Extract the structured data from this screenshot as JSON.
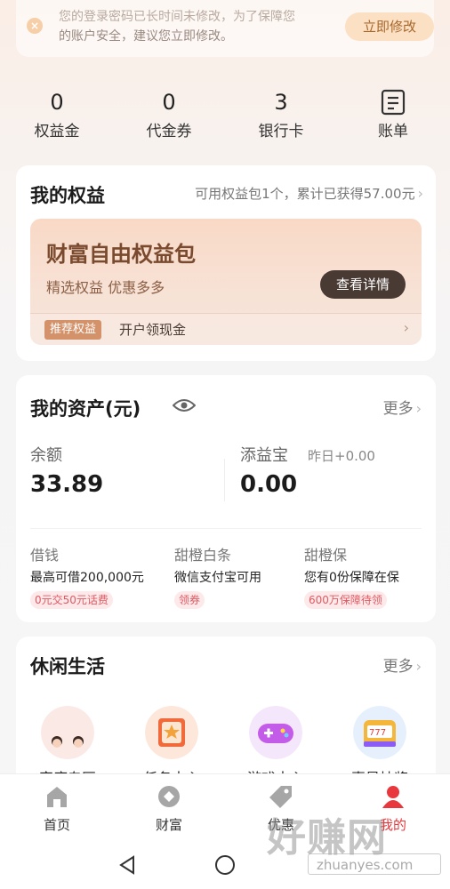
{
  "notice": {
    "line1": "您的登录密码已长时间未修改，为了保障您",
    "line2": "的账户安全，建议您立即修改。",
    "button": "立即修改"
  },
  "stats": [
    {
      "value": "0",
      "label": "权益金"
    },
    {
      "value": "0",
      "label": "代金券"
    },
    {
      "value": "3",
      "label": "银行卡"
    },
    {
      "label": "账单"
    }
  ],
  "benefits": {
    "title": "我的权益",
    "summary": "可用权益包1个，累计已获得57.00元",
    "pack_title": "财富自由权益包",
    "pack_subtitle": "精选权益 优惠多多",
    "pack_button": "查看详情",
    "tag": "推荐权益",
    "footer_text": "开户领现金"
  },
  "assets": {
    "title": "我的资产(元)",
    "more": "更多",
    "balance_label": "余额",
    "balance_value": "33.89",
    "tianyibao_label": "添益宝",
    "tianyibao_value": "0.00",
    "yesterday": "昨日+0.00",
    "products": [
      {
        "name": "借钱",
        "desc": "最高可借200,000元",
        "tag": "0元交50元话费"
      },
      {
        "name": "甜橙白条",
        "desc": "微信支付宝可用",
        "tag": "领券"
      },
      {
        "name": "甜橙保",
        "desc": "您有0份保障在保",
        "tag": "600万保障待领"
      }
    ]
  },
  "leisure": {
    "title": "休闲生活",
    "more": "更多",
    "items": [
      {
        "label": "家庭专区",
        "icon": "family-icon"
      },
      {
        "label": "任务中心",
        "icon": "task-icon"
      },
      {
        "label": "游戏中心",
        "icon": "gamepad-icon"
      },
      {
        "label": "惠星抽奖",
        "icon": "slot-machine-icon"
      }
    ]
  },
  "tabbar": [
    {
      "label": "首页",
      "icon": "home-icon"
    },
    {
      "label": "财富",
      "icon": "wealth-icon"
    },
    {
      "label": "优惠",
      "icon": "coupon-icon"
    },
    {
      "label": "我的",
      "icon": "profile-icon"
    }
  ],
  "watermark": {
    "brand": "好赚网",
    "url": "zhuanyes.com"
  },
  "colors": {
    "accent": "#e8383d",
    "gold": "#a8672c",
    "pack_bg": "#f9d9c6"
  }
}
